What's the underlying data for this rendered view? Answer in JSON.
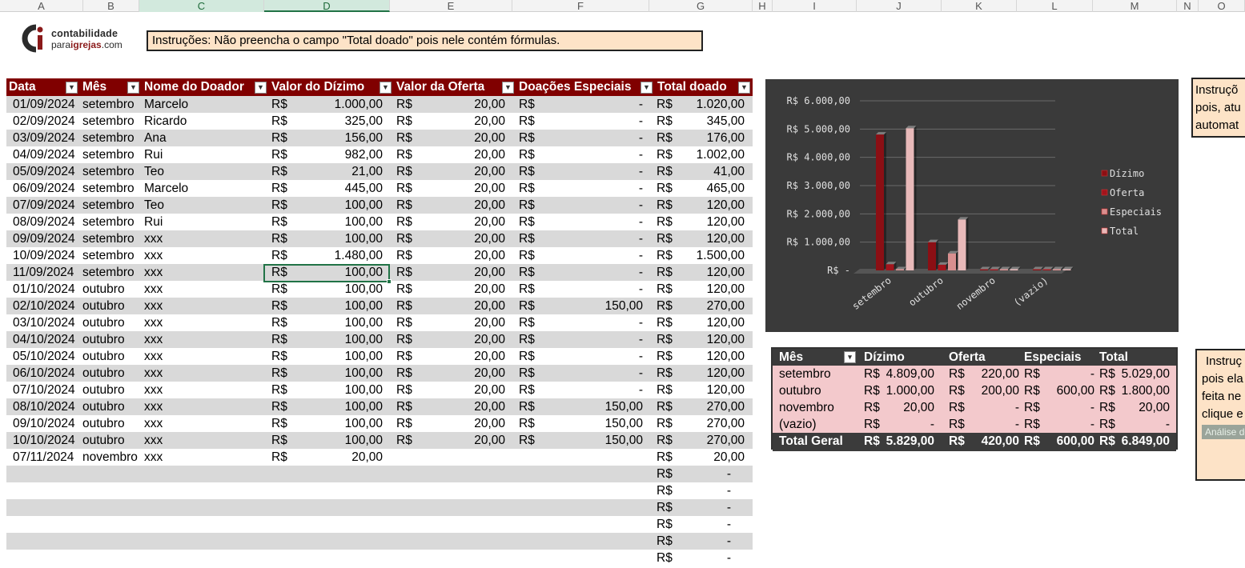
{
  "columns": [
    "A",
    "B",
    "C",
    "D",
    "E",
    "F",
    "G",
    "H",
    "I",
    "J",
    "K",
    "L",
    "M",
    "N",
    "O"
  ],
  "logo": {
    "line1": "contabilidade",
    "line2_a": "para",
    "line2_b": "igrejas",
    "line2_c": ".com"
  },
  "instruction_top": "Instruções: Não preencha o campo \"Total doado\" pois nele contém fórmulas.",
  "table": {
    "headers": [
      "Data",
      "Mês",
      "Nome do Doador",
      "Valor do Dízimo",
      "Valor da Oferta",
      "Doações Especiais",
      "Total doado"
    ],
    "currency": "R$",
    "rows": [
      {
        "data": "01/09/2024",
        "mes": "setembro",
        "nome": "Marcelo",
        "dizimo": "1.000,00",
        "oferta": "20,00",
        "especiais": "-",
        "total": "1.020,00"
      },
      {
        "data": "02/09/2024",
        "mes": "setembro",
        "nome": "Ricardo",
        "dizimo": "325,00",
        "oferta": "20,00",
        "especiais": "-",
        "total": "345,00"
      },
      {
        "data": "03/09/2024",
        "mes": "setembro",
        "nome": "Ana",
        "dizimo": "156,00",
        "oferta": "20,00",
        "especiais": "-",
        "total": "176,00"
      },
      {
        "data": "04/09/2024",
        "mes": "setembro",
        "nome": "Rui",
        "dizimo": "982,00",
        "oferta": "20,00",
        "especiais": "-",
        "total": "1.002,00"
      },
      {
        "data": "05/09/2024",
        "mes": "setembro",
        "nome": "Teo",
        "dizimo": "21,00",
        "oferta": "20,00",
        "especiais": "-",
        "total": "41,00"
      },
      {
        "data": "06/09/2024",
        "mes": "setembro",
        "nome": "Marcelo",
        "dizimo": "445,00",
        "oferta": "20,00",
        "especiais": "-",
        "total": "465,00"
      },
      {
        "data": "07/09/2024",
        "mes": "setembro",
        "nome": "Teo",
        "dizimo": "100,00",
        "oferta": "20,00",
        "especiais": "-",
        "total": "120,00"
      },
      {
        "data": "08/09/2024",
        "mes": "setembro",
        "nome": "Rui",
        "dizimo": "100,00",
        "oferta": "20,00",
        "especiais": "-",
        "total": "120,00"
      },
      {
        "data": "09/09/2024",
        "mes": "setembro",
        "nome": "xxx",
        "dizimo": "100,00",
        "oferta": "20,00",
        "especiais": "-",
        "total": "120,00"
      },
      {
        "data": "10/09/2024",
        "mes": "setembro",
        "nome": "xxx",
        "dizimo": "1.480,00",
        "oferta": "20,00",
        "especiais": "-",
        "total": "1.500,00"
      },
      {
        "data": "11/09/2024",
        "mes": "setembro",
        "nome": "xxx",
        "dizimo": "100,00",
        "oferta": "20,00",
        "especiais": "-",
        "total": "120,00"
      },
      {
        "data": "01/10/2024",
        "mes": "outubro",
        "nome": "xxx",
        "dizimo": "100,00",
        "oferta": "20,00",
        "especiais": "-",
        "total": "120,00"
      },
      {
        "data": "02/10/2024",
        "mes": "outubro",
        "nome": "xxx",
        "dizimo": "100,00",
        "oferta": "20,00",
        "especiais": "150,00",
        "total": "270,00"
      },
      {
        "data": "03/10/2024",
        "mes": "outubro",
        "nome": "xxx",
        "dizimo": "100,00",
        "oferta": "20,00",
        "especiais": "-",
        "total": "120,00"
      },
      {
        "data": "04/10/2024",
        "mes": "outubro",
        "nome": "xxx",
        "dizimo": "100,00",
        "oferta": "20,00",
        "especiais": "-",
        "total": "120,00"
      },
      {
        "data": "05/10/2024",
        "mes": "outubro",
        "nome": "xxx",
        "dizimo": "100,00",
        "oferta": "20,00",
        "especiais": "-",
        "total": "120,00"
      },
      {
        "data": "06/10/2024",
        "mes": "outubro",
        "nome": "xxx",
        "dizimo": "100,00",
        "oferta": "20,00",
        "especiais": "-",
        "total": "120,00"
      },
      {
        "data": "07/10/2024",
        "mes": "outubro",
        "nome": "xxx",
        "dizimo": "100,00",
        "oferta": "20,00",
        "especiais": "-",
        "total": "120,00"
      },
      {
        "data": "08/10/2024",
        "mes": "outubro",
        "nome": "xxx",
        "dizimo": "100,00",
        "oferta": "20,00",
        "especiais": "150,00",
        "total": "270,00"
      },
      {
        "data": "09/10/2024",
        "mes": "outubro",
        "nome": "xxx",
        "dizimo": "100,00",
        "oferta": "20,00",
        "especiais": "150,00",
        "total": "270,00"
      },
      {
        "data": "10/10/2024",
        "mes": "outubro",
        "nome": "xxx",
        "dizimo": "100,00",
        "oferta": "20,00",
        "especiais": "150,00",
        "total": "270,00"
      },
      {
        "data": "07/11/2024",
        "mes": "novembro",
        "nome": "xxx",
        "dizimo": "20,00",
        "oferta": "",
        "especiais": "",
        "total": "20,00"
      }
    ],
    "empty_total": "-",
    "empty_rows": 6
  },
  "chart_data": {
    "type": "bar",
    "categories": [
      "setembro",
      "outubro",
      "novembro",
      "(vazio)"
    ],
    "series": [
      {
        "name": "Dízimo",
        "values": [
          4809,
          1000,
          20,
          0
        ]
      },
      {
        "name": "Oferta",
        "values": [
          220,
          200,
          0,
          0
        ]
      },
      {
        "name": "Especiais",
        "values": [
          0,
          600,
          0,
          0
        ]
      },
      {
        "name": "Total",
        "values": [
          5029,
          1800,
          20,
          0
        ]
      }
    ],
    "ylim": [
      0,
      6000
    ],
    "yticks": [
      "R$ -",
      "R$ 1.000,00",
      "R$ 2.000,00",
      "R$ 3.000,00",
      "R$ 4.000,00",
      "R$ 5.000,00",
      "R$ 6.000,00"
    ],
    "legend": "right",
    "grid": true,
    "colors": [
      "#8b0f14",
      "#a3141c",
      "#d98f8f",
      "#e8b9b9"
    ],
    "background": "#3a3a3a"
  },
  "pivot": {
    "headers": [
      "Mês",
      "Dízimo",
      "Oferta",
      "Especiais",
      "Total"
    ],
    "rows": [
      {
        "mes": "setembro",
        "dizimo": "4.809,00",
        "oferta": "220,00",
        "especiais": "-",
        "total": "5.029,00"
      },
      {
        "mes": "outubro",
        "dizimo": "1.000,00",
        "oferta": "200,00",
        "especiais": "600,00",
        "total": "1.800,00"
      },
      {
        "mes": "novembro",
        "dizimo": "20,00",
        "oferta": "-",
        "especiais": "-",
        "total": "20,00"
      },
      {
        "mes": "(vazio)",
        "dizimo": "-",
        "oferta": "-",
        "especiais": "-",
        "total": "-"
      }
    ],
    "total": {
      "mes": "Total Geral",
      "dizimo": "5.829,00",
      "oferta": "420,00",
      "especiais": "600,00",
      "total": "6.849,00"
    }
  },
  "instr_right1": [
    "Instruçõ",
    "pois, atu",
    "automat"
  ],
  "instr_right2": [
    "Instruç",
    "pois ela",
    "feita ne",
    "clique e"
  ],
  "pivot_button": "Análise de",
  "colors": {
    "header": "#800000",
    "shade": "#d9d9d9",
    "note_bg": "#fde3c7",
    "pivot_bg": "#f3c9cc",
    "selection": "#217346"
  }
}
